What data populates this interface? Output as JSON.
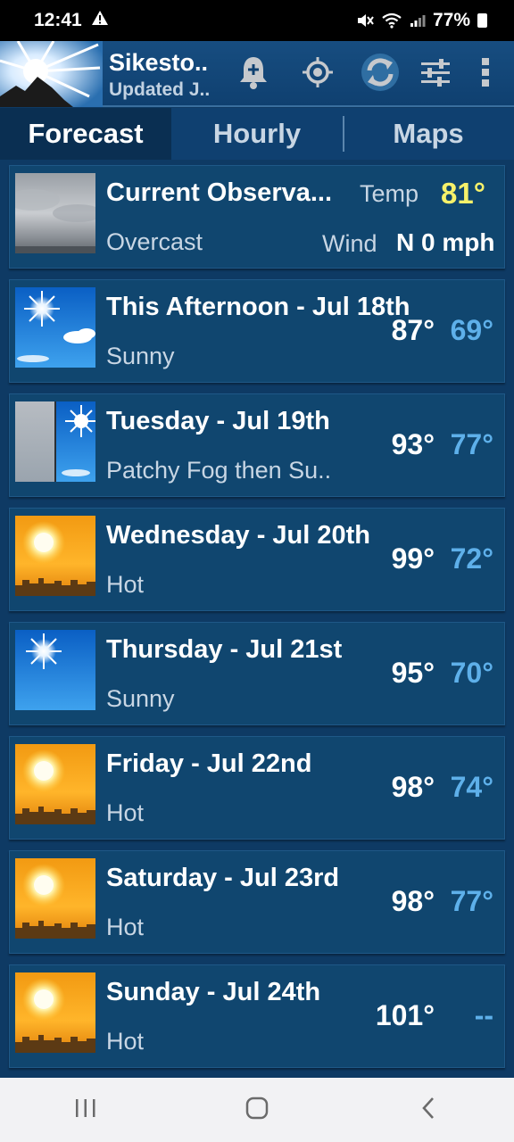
{
  "status_bar": {
    "time": "12:41",
    "battery_percent": "77%",
    "icons": [
      "alert-icon",
      "mute-icon",
      "wifi-icon",
      "signal-icon",
      "battery-icon"
    ]
  },
  "app_bar": {
    "title": "Sikesto..",
    "subtitle": "Updated J..",
    "actions": [
      "alert-bell-icon",
      "location-icon",
      "refresh-icon",
      "settings-sliders-icon",
      "more-icon"
    ]
  },
  "tabs": [
    {
      "label": "Forecast",
      "active": true
    },
    {
      "label": "Hourly",
      "active": false
    },
    {
      "label": "Maps",
      "active": false
    }
  ],
  "current": {
    "title": "Current Observa...",
    "condition": "Overcast",
    "temp_label": "Temp",
    "temp": "81°",
    "wind_label": "Wind",
    "wind": "N 0 mph"
  },
  "forecast": [
    {
      "title": "This Afternoon - Jul 18th",
      "condition": "Sunny",
      "hi": "87°",
      "lo": "69°",
      "icon": "sunny-sky-icon"
    },
    {
      "title": "Tuesday - Jul 19th",
      "condition": "Patchy Fog then Su..",
      "hi": "93°",
      "lo": "77°",
      "icon": "fog-then-sun-icon"
    },
    {
      "title": "Wednesday - Jul 20th",
      "condition": "Hot",
      "hi": "99°",
      "lo": "72°",
      "icon": "hot-sun-icon"
    },
    {
      "title": "Thursday - Jul 21st",
      "condition": "Sunny",
      "hi": "95°",
      "lo": "70°",
      "icon": "sunny-sky-icon"
    },
    {
      "title": "Friday - Jul 22nd",
      "condition": "Hot",
      "hi": "98°",
      "lo": "74°",
      "icon": "hot-sun-icon"
    },
    {
      "title": "Saturday - Jul 23rd",
      "condition": "Hot",
      "hi": "98°",
      "lo": "77°",
      "icon": "hot-sun-icon"
    },
    {
      "title": "Sunday - Jul 24th",
      "condition": "Hot",
      "hi": "101°",
      "lo": "--",
      "icon": "hot-sun-icon"
    }
  ],
  "colors": {
    "background": "#0e3a64",
    "card": "#10466f",
    "hi_temp": "#ffffff",
    "lo_temp": "#5eb0ea",
    "current_temp": "#f6f16a"
  }
}
